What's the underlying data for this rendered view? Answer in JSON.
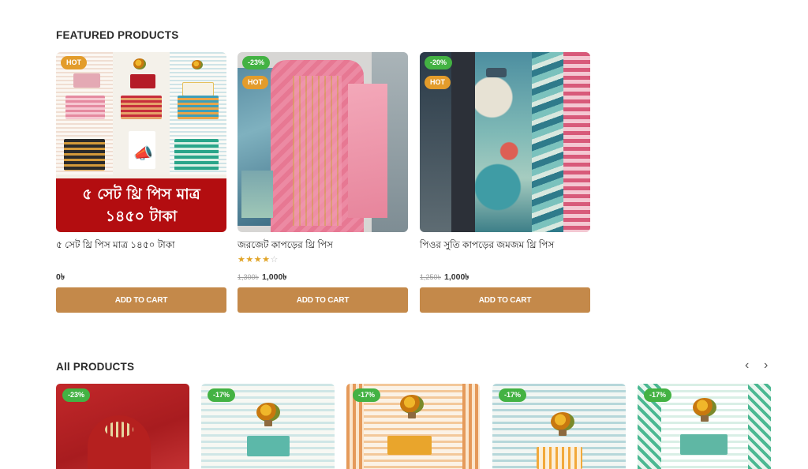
{
  "featured": {
    "title": "FEATURED PRODUCTS",
    "products": [
      {
        "badges": [
          "HOT"
        ],
        "banner_line1": "৫ সেট থ্রি পিস মাত্র",
        "banner_line2": "১৪৫০ টাকা",
        "name": "৫ সেট থ্রি পিস মাত্র ১৪৫০ টাকা",
        "old_price": "",
        "price": "0৳",
        "rating": 0,
        "cart_label": "ADD TO CART"
      },
      {
        "badges": [
          "-23%",
          "HOT"
        ],
        "name": "জরজেট কাপড়ের থ্রি পিস",
        "old_price": "1,300৳",
        "price": "1,000৳",
        "rating": 4,
        "cart_label": "ADD TO CART"
      },
      {
        "badges": [
          "-20%",
          "HOT"
        ],
        "name": "পিওর সুতি কাপড়ের জমজম থ্রি পিস",
        "old_price": "1,250৳",
        "price": "1,000৳",
        "rating": 0,
        "cart_label": "ADD TO CART"
      }
    ]
  },
  "all_products": {
    "title": "All PRODUCTS",
    "prev_icon": "chevron-left-icon",
    "next_icon": "chevron-right-icon",
    "tiles": [
      {
        "badge": "-23%"
      },
      {
        "badge": "-17%"
      },
      {
        "badge": "-17%"
      },
      {
        "badge": "-17%"
      },
      {
        "badge": "-17%"
      }
    ]
  },
  "colors": {
    "cart_button": "#c4894a",
    "sale_badge": "#43b243",
    "hot_badge": "#e39c2b",
    "banner_red": "#b30d10",
    "star": "#e1a427"
  }
}
